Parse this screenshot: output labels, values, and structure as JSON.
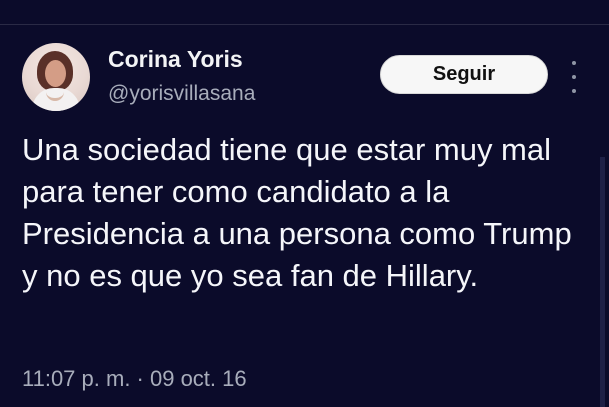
{
  "tweet": {
    "author_name": "Corina Yoris",
    "author_handle": "@yorisvillasana",
    "follow_button_label": "Seguir",
    "text": "Una sociedad tiene que estar muy mal para tener como candidato a la Presidencia a una persona como Trump y no es que yo sea fan de Hillary.",
    "timestamp": "11:07 p. m. · 09 oct. 16"
  },
  "icons": {
    "avatar": "profile-photo",
    "more": "more-options-icon"
  },
  "colors": {
    "background": "#0b0b2a",
    "text_primary": "#f5f6fa",
    "text_secondary": "#a8adbb",
    "button_background": "#f7f7f7"
  }
}
